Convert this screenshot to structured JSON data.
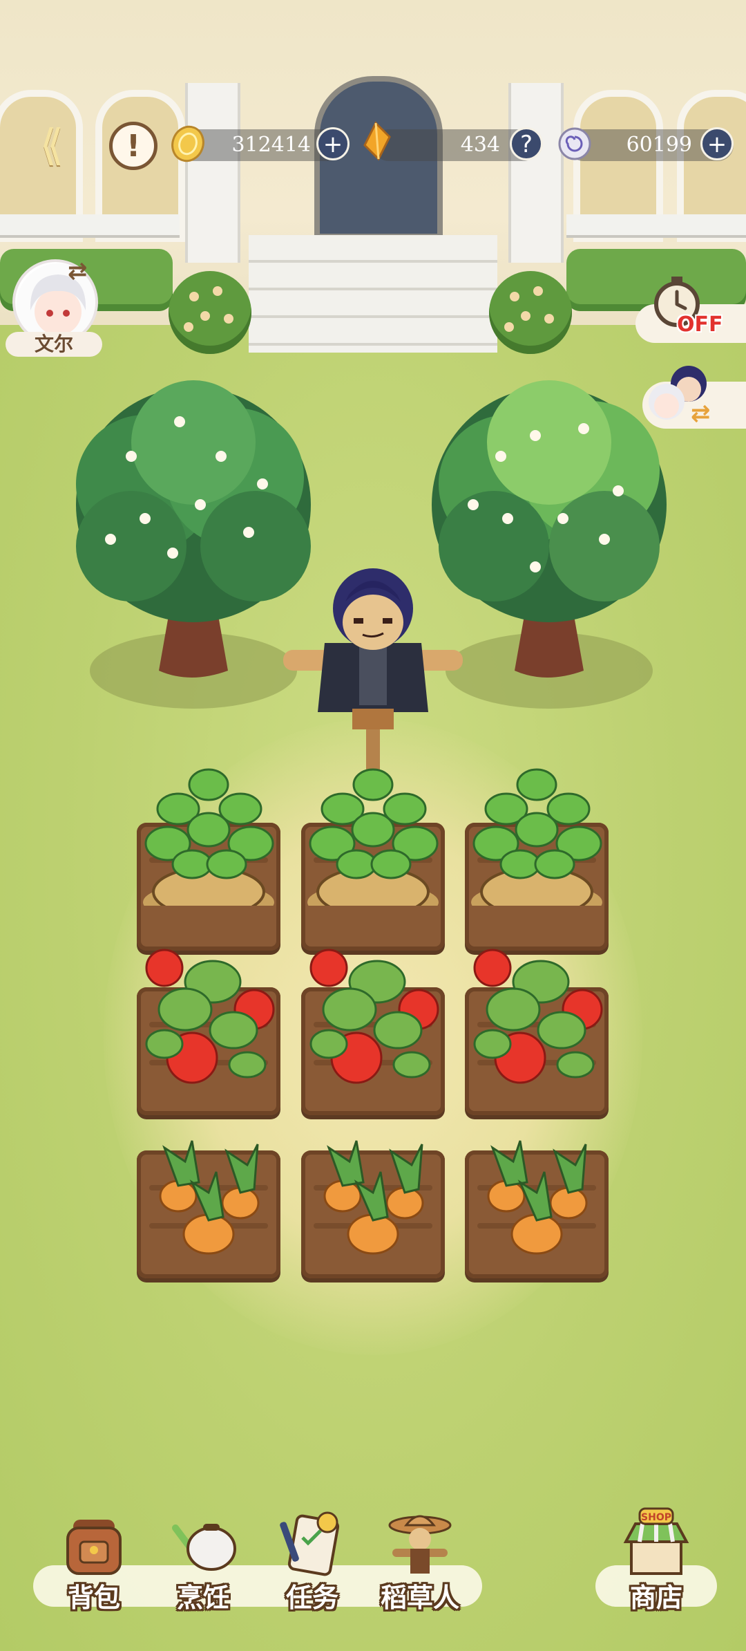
{
  "hud": {
    "back_icon": "back-arrow-icon",
    "alert_icon": "exclamation-icon",
    "gold": {
      "icon": "gold-coin-icon",
      "value": "312414",
      "add": "+"
    },
    "crystal": {
      "icon": "amber-crystal-icon",
      "value": "434",
      "help": "?"
    },
    "token": {
      "icon": "spiral-token-icon",
      "value": "60199",
      "add": "+"
    }
  },
  "character": {
    "name": "文尔",
    "swap_icon": "swap-arrows-icon"
  },
  "auto_timer": {
    "icon": "stopwatch-icon",
    "state": "OFF"
  },
  "scarecrow_swap": {
    "icon": "character-swap-icon"
  },
  "field": {
    "rows": [
      {
        "crop": "potato",
        "count": 3
      },
      {
        "crop": "tomato",
        "count": 3
      },
      {
        "crop": "carrot",
        "count": 3
      }
    ],
    "trees": [
      "flowering-tree",
      "flowering-tree"
    ]
  },
  "nav": {
    "bag": {
      "label": "背包",
      "icon": "backpack-icon"
    },
    "cook": {
      "label": "烹饪",
      "icon": "cooking-pot-icon"
    },
    "quest": {
      "label": "任务",
      "icon": "quest-clipboard-icon"
    },
    "scarecrow": {
      "label": "稻草人",
      "icon": "scarecrow-icon"
    },
    "shop": {
      "label": "商店",
      "sign": "SHOP",
      "icon": "shop-stall-icon"
    }
  },
  "colors": {
    "accent": "#3b4a6d",
    "soil": "#8a5a36",
    "grass": "#bdd171",
    "off_red": "#e2322e"
  }
}
